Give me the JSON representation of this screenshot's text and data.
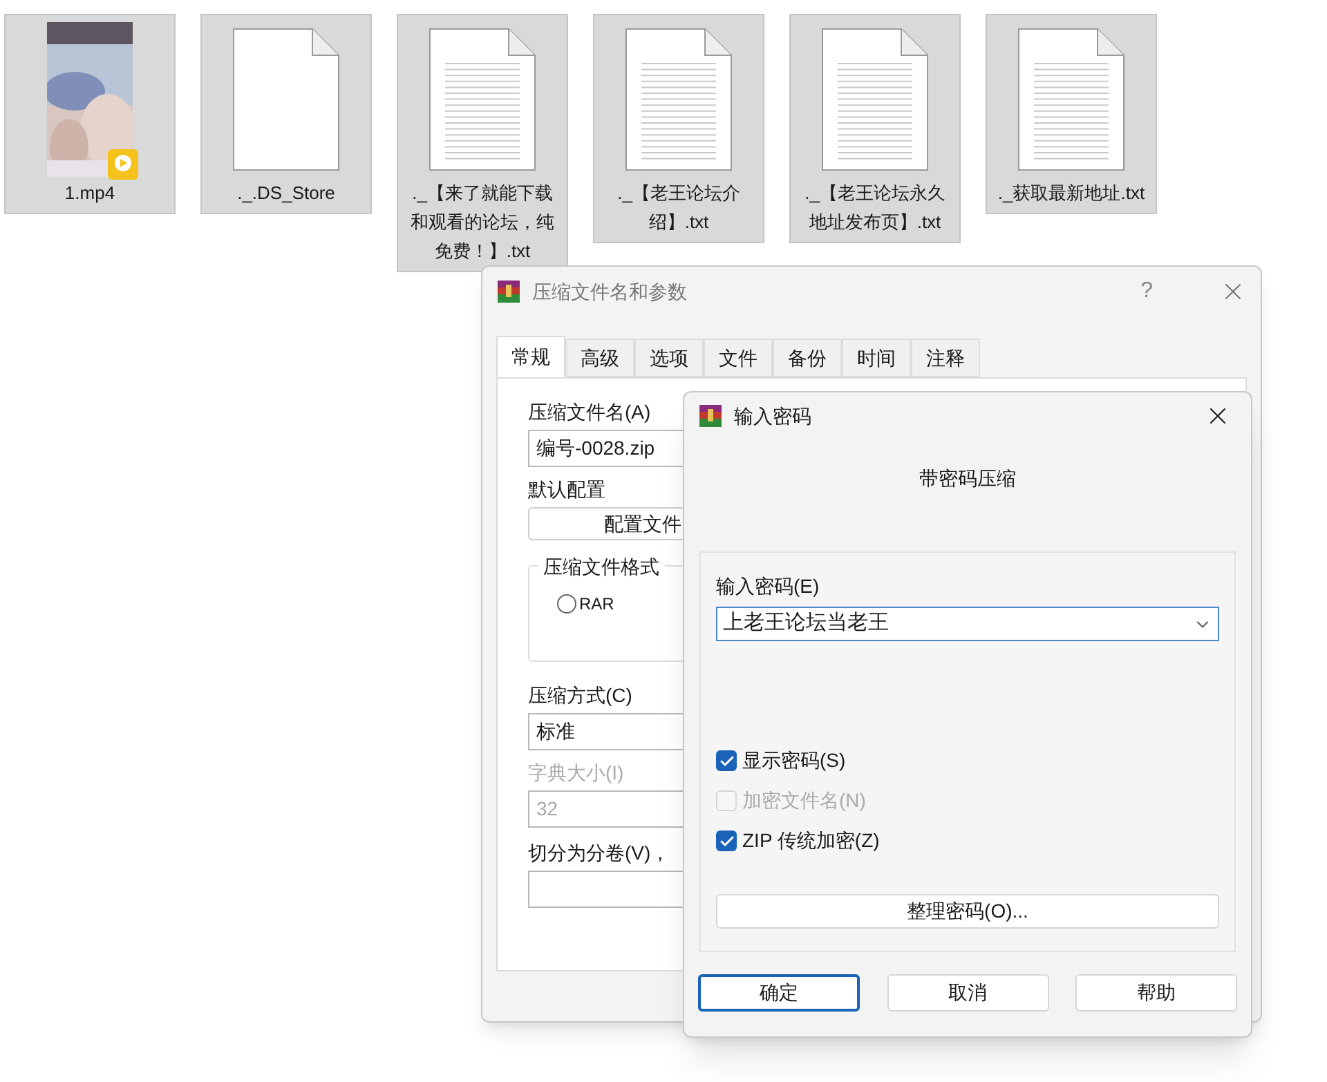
{
  "files": [
    {
      "name": "1.mp4",
      "kind": "video"
    },
    {
      "name": "._.DS_Store",
      "kind": "blank"
    },
    {
      "name": "._【来了就能下载和观看的论坛，纯免费！】.txt",
      "kind": "text"
    },
    {
      "name": "._【老王论坛介绍】.txt",
      "kind": "text"
    },
    {
      "name": "._【老王论坛永久地址发布页】.txt",
      "kind": "text"
    },
    {
      "name": "._获取最新地址.txt",
      "kind": "text"
    }
  ],
  "back_dialog": {
    "title": "压缩文件名和参数",
    "help": "?",
    "tabs": [
      {
        "label": "常规",
        "selected": true
      },
      {
        "label": "高级",
        "selected": false
      },
      {
        "label": "选项",
        "selected": false
      },
      {
        "label": "文件",
        "selected": false
      },
      {
        "label": "备份",
        "selected": false
      },
      {
        "label": "时间",
        "selected": false
      },
      {
        "label": "注释",
        "selected": false
      }
    ],
    "archive_name": {
      "label": "压缩文件名(A)",
      "value": "编号-0028.zip"
    },
    "profile": {
      "label": "默认配置",
      "button": "配置文件"
    },
    "format_group": {
      "title": "压缩文件格式",
      "options": [
        {
          "label": "RAR",
          "selected": false
        }
      ]
    },
    "method": {
      "label": "压缩方式(C)",
      "value": "标准"
    },
    "dictionary": {
      "label": "字典大小(I)",
      "value": "32",
      "disabled": true
    },
    "split": {
      "label": "切分为分卷(V)，"
    }
  },
  "password_dialog": {
    "title": "输入密码",
    "heading": "带密码压缩",
    "password": {
      "label": "输入密码(E)",
      "value": "上老王论坛当老王"
    },
    "options": [
      {
        "label": "显示密码(S)",
        "checked": true,
        "disabled": false
      },
      {
        "label": "加密文件名(N)",
        "checked": false,
        "disabled": true
      },
      {
        "label": "ZIP 传统加密(Z)",
        "checked": true,
        "disabled": false
      }
    ],
    "organize_button": "整理密码(O)...",
    "buttons": [
      {
        "label": "确定",
        "default": true
      },
      {
        "label": "取消",
        "default": false
      },
      {
        "label": "帮助",
        "default": false
      }
    ]
  }
}
